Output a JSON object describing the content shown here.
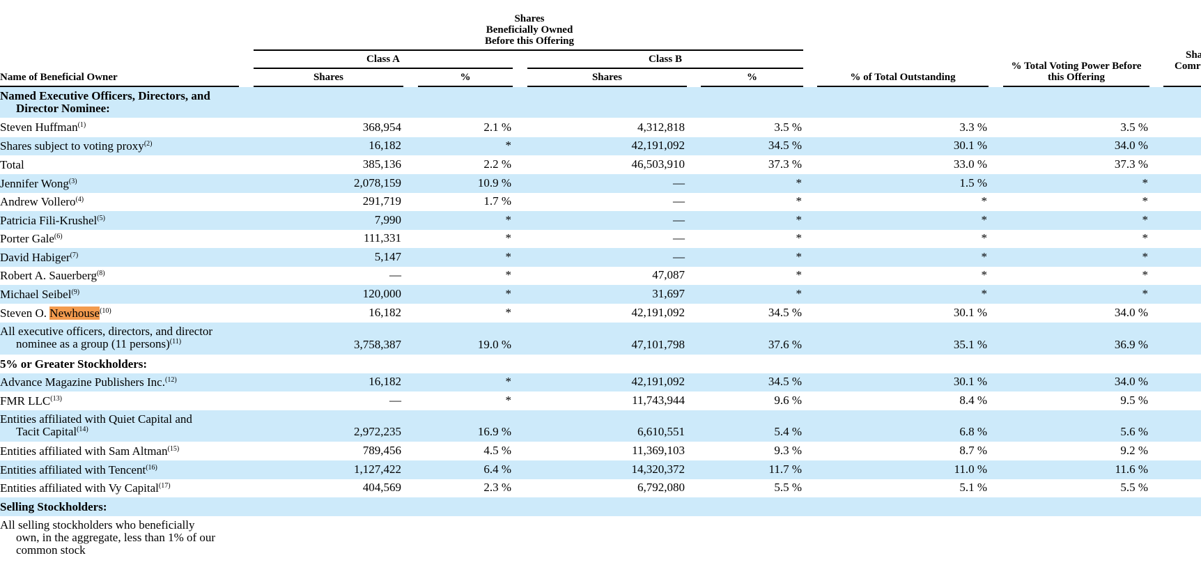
{
  "headers": {
    "group_title": [
      "Shares",
      "Beneficially Owned",
      "Before this Offering"
    ],
    "class_a": "Class A",
    "class_b": "Class B",
    "name_col": "Name of Beneficial Owner",
    "shares_a": "Shares",
    "pct_a": "%",
    "shares_b": "Shares",
    "pct_b": "%",
    "pct_total_outstanding": "% of Total Outstanding",
    "pct_voting_power": [
      "% Total Voting Power Before",
      "this Offering"
    ],
    "cut_off": [
      "Sha",
      "Comr"
    ]
  },
  "rows": [
    {
      "name": "Named Executive Officers, Directors, and",
      "name2": "Director Nominee:",
      "bold": true,
      "sup": "",
      "values": [
        "",
        "",
        "",
        "",
        "",
        ""
      ]
    },
    {
      "name": "Steven Huffman",
      "sup": "(1)",
      "values": [
        "368,954",
        "2.1 %",
        "4,312,818",
        "3.5 %",
        "3.3 %",
        "3.5 %"
      ]
    },
    {
      "name": "Shares subject to voting proxy",
      "sup": "(2)",
      "values": [
        "16,182",
        "*",
        "42,191,092",
        "34.5 %",
        "30.1 %",
        "34.0 %"
      ]
    },
    {
      "name": "Total",
      "sup": "",
      "values": [
        "385,136",
        "2.2 %",
        "46,503,910",
        "37.3 %",
        "33.0 %",
        "37.3 %"
      ]
    },
    {
      "name": "Jennifer Wong",
      "sup": "(3)",
      "values": [
        "2,078,159",
        "10.9 %",
        "—",
        "*",
        "1.5 %",
        "*"
      ]
    },
    {
      "name": "Andrew Vollero",
      "sup": "(4)",
      "values": [
        "291,719",
        "1.7 %",
        "—",
        "*",
        "*",
        "*"
      ]
    },
    {
      "name": "Patricia Fili-Krushel",
      "sup": "(5)",
      "values": [
        "7,990",
        "*",
        "—",
        "*",
        "*",
        "*"
      ]
    },
    {
      "name": "Porter Gale",
      "sup": "(6)",
      "values": [
        "111,331",
        "*",
        "—",
        "*",
        "*",
        "*"
      ]
    },
    {
      "name": "David Habiger",
      "sup": "(7)",
      "values": [
        "5,147",
        "*",
        "—",
        "*",
        "*",
        "*"
      ]
    },
    {
      "name": "Robert A. Sauerberg",
      "sup": "(8)",
      "values": [
        "—",
        "*",
        "47,087",
        "*",
        "*",
        "*"
      ]
    },
    {
      "name": "Michael Seibel",
      "sup": "(9)",
      "values": [
        "120,000",
        "*",
        "31,697",
        "*",
        "*",
        "*"
      ]
    },
    {
      "name": "Steven O. ",
      "name_hl": "Newhouse",
      "sup": "(10)",
      "values": [
        "16,182",
        "*",
        "42,191,092",
        "34.5 %",
        "30.1 %",
        "34.0 %"
      ]
    },
    {
      "name": "All executive officers, directors, and director",
      "name2": "nominee as a group (11 persons)",
      "sup": "(11)",
      "values": [
        "3,758,387",
        "19.0 %",
        "47,101,798",
        "37.6 %",
        "35.1 %",
        "36.9 %"
      ]
    },
    {
      "name": "5% or Greater Stockholders:",
      "bold": true,
      "sup": "",
      "values": [
        "",
        "",
        "",
        "",
        "",
        ""
      ]
    },
    {
      "name": "Advance Magazine Publishers Inc.",
      "sup": "(12)",
      "values": [
        "16,182",
        "*",
        "42,191,092",
        "34.5 %",
        "30.1 %",
        "34.0 %"
      ]
    },
    {
      "name": "FMR LLC",
      "sup": "(13)",
      "values": [
        "—",
        "*",
        "11,743,944",
        "9.6 %",
        "8.4 %",
        "9.5 %"
      ]
    },
    {
      "name": "Entities affiliated with Quiet Capital and",
      "name2": "Tacit Capital",
      "sup": "(14)",
      "values": [
        "2,972,235",
        "16.9 %",
        "6,610,551",
        "5.4 %",
        "6.8 %",
        "5.6 %"
      ]
    },
    {
      "name": "Entities affiliated with Sam Altman",
      "sup": "(15)",
      "values": [
        "789,456",
        "4.5 %",
        "11,369,103",
        "9.3 %",
        "8.7 %",
        "9.2 %"
      ]
    },
    {
      "name": "Entities affiliated with Tencent",
      "sup": "(16)",
      "values": [
        "1,127,422",
        "6.4 %",
        "14,320,372",
        "11.7 %",
        "11.0 %",
        "11.6 %"
      ]
    },
    {
      "name": "Entities affiliated with Vy Capital",
      "sup": "(17)",
      "values": [
        "404,569",
        "2.3 %",
        "6,792,080",
        "5.5 %",
        "5.1 %",
        "5.5 %"
      ]
    },
    {
      "name": "Selling Stockholders:",
      "bold": true,
      "sup": "",
      "values": [
        "",
        "",
        "",
        "",
        "",
        ""
      ]
    },
    {
      "name": "All selling stockholders who beneficially",
      "name2": "own, in the aggregate, less than 1% of our",
      "name3": "common stock",
      "sup": "",
      "values": [
        "",
        "",
        "",
        "",
        "",
        ""
      ]
    }
  ],
  "colors": {
    "shade": "#cdeafa",
    "highlight": "#f39b4e"
  }
}
